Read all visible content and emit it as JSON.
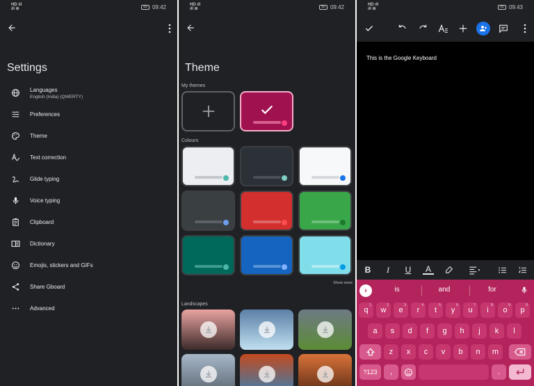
{
  "status": {
    "left_lines": [
      "HD ıll",
      "ıll ⊜"
    ],
    "battery": "85",
    "times": [
      "09:42",
      "09:42",
      "09:43"
    ]
  },
  "settings": {
    "title": "Settings",
    "items": [
      {
        "icon": "globe-icon",
        "label": "Languages",
        "sub": "English (India) (QWERTY)"
      },
      {
        "icon": "sliders-icon",
        "label": "Preferences",
        "sub": ""
      },
      {
        "icon": "palette-icon",
        "label": "Theme",
        "sub": ""
      },
      {
        "icon": "text-correction-icon",
        "label": "Text correction",
        "sub": ""
      },
      {
        "icon": "glide-typing-icon",
        "label": "Glide typing",
        "sub": ""
      },
      {
        "icon": "microphone-icon",
        "label": "Voice typing",
        "sub": ""
      },
      {
        "icon": "clipboard-icon",
        "label": "Clipboard",
        "sub": ""
      },
      {
        "icon": "dictionary-icon",
        "label": "Dictionary",
        "sub": ""
      },
      {
        "icon": "emoji-icon",
        "label": "Emojis, stickers and GIFs",
        "sub": ""
      },
      {
        "icon": "share-icon",
        "label": "Share Gboard",
        "sub": ""
      },
      {
        "icon": "more-horiz-icon",
        "label": "Advanced",
        "sub": ""
      }
    ]
  },
  "theme": {
    "title": "Theme",
    "my_themes_label": "My themes",
    "colours_label": "Colours",
    "show_more": "Show more",
    "landscapes_label": "Landscapes",
    "my_theme_color": "#a0114f",
    "colours": [
      {
        "bg": "#eceef1",
        "bar": "#c4c7cc",
        "dot": "#4fb8ad"
      },
      {
        "bg": "#2b3137",
        "bar": "#4a5158",
        "dot": "#7fcfc4"
      },
      {
        "bg": "#f7f8fa",
        "bar": "#d5d8dc",
        "dot": "#1a73e8"
      },
      {
        "bg": "#3a3f42",
        "bar": "#5b6166",
        "dot": "#6d9eeb"
      },
      {
        "bg": "#d32f2f",
        "bar": "#e06666",
        "dot": "#ff4d4d"
      },
      {
        "bg": "#3aa64a",
        "bar": "#6cc07a",
        "dot": "#1f7a2d"
      },
      {
        "bg": "#00695c",
        "bar": "#3f9c8f",
        "dot": "#4db6ac"
      },
      {
        "bg": "#1565c0",
        "bar": "#5b94d6",
        "dot": "#82b1ff"
      },
      {
        "bg": "#80deea",
        "bar": "#b2ebf2",
        "dot": "#039be5"
      }
    ],
    "landscapes": [
      {
        "top": "#e8a3a0",
        "bottom": "#3d2b2b"
      },
      {
        "top": "#5c7fa6",
        "bottom": "#c0e0f0"
      },
      {
        "top": "#6e7a85",
        "bottom": "#5c8c35"
      },
      {
        "top": "#a7b8c9",
        "bottom": "#5a6470"
      },
      {
        "top": "#c24a1f",
        "bottom": "#3a7fb0"
      },
      {
        "top": "#d9733a",
        "bottom": "#5a2a14"
      }
    ]
  },
  "docs": {
    "text": "This is the Google Keyboard",
    "toolbar_icons": [
      "check-icon",
      "undo-icon",
      "redo-icon",
      "text-format-icon",
      "add-icon",
      "add-person-icon",
      "comment-icon",
      "more-vert-icon"
    ],
    "format_icons": [
      "bold-icon",
      "italic-icon",
      "underline-icon",
      "text-color-icon",
      "highlight-icon",
      "align-icon",
      "bullet-list-icon",
      "numbered-list-icon"
    ],
    "format_labels": {
      "bold": "B",
      "italic": "I",
      "underline": "U",
      "textcolor": "A"
    }
  },
  "keyboard": {
    "color": "#b3245c",
    "suggestions": [
      "is",
      "and",
      "for"
    ],
    "row1": [
      [
        "q",
        "1"
      ],
      [
        "w",
        "2"
      ],
      [
        "e",
        "3"
      ],
      [
        "r",
        "4"
      ],
      [
        "t",
        "5"
      ],
      [
        "y",
        "6"
      ],
      [
        "u",
        "7"
      ],
      [
        "i",
        "8"
      ],
      [
        "o",
        "9"
      ],
      [
        "p",
        "0"
      ]
    ],
    "row2": [
      "a",
      "s",
      "d",
      "f",
      "g",
      "h",
      "j",
      "k",
      "l"
    ],
    "row3": [
      "z",
      "x",
      "c",
      "v",
      "b",
      "n",
      "m"
    ],
    "sym_label": "?123",
    "comma": ",",
    "period": "."
  }
}
